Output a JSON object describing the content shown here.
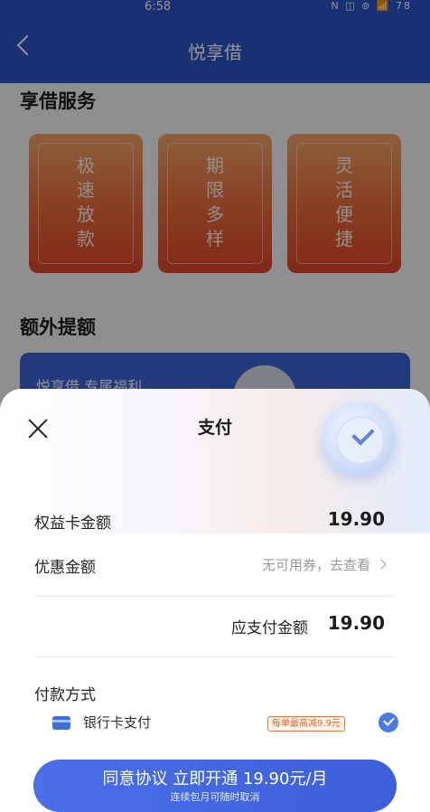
{
  "status_bar": {
    "time": "6:58",
    "icons_text": "N ◫ ⊚ 📶 78",
    "battery": "78"
  },
  "nav": {
    "title": "悦享借"
  },
  "sections": {
    "services_title": "享借服务",
    "extra_title": "额外提额"
  },
  "features": [
    {
      "text": "极\n速\n放\n款"
    },
    {
      "text": "期\n限\n多\n样"
    },
    {
      "text": "灵\n活\n便\n捷"
    }
  ],
  "promo_card": {
    "text": "悦享借 专属福利"
  },
  "sheet": {
    "title": "支付",
    "rows": [
      {
        "label": "权益卡金额",
        "value": "19.90"
      },
      {
        "label": "优惠金额",
        "value": "无可用券，去查看"
      }
    ],
    "total": {
      "label": "应支付金额",
      "value": "19.90"
    },
    "payment": {
      "title": "付款方式",
      "method_label": "银行卡支付",
      "promo_tag": "每单最高减9.9元"
    },
    "cta": {
      "main": "同意协议 立即开通 19.90元/月",
      "sub": "连续包月可随时取消"
    }
  },
  "colors": {
    "brand": "#2b55c6",
    "cta": "#4a6fe6",
    "accent_orange": "#e0452a"
  }
}
